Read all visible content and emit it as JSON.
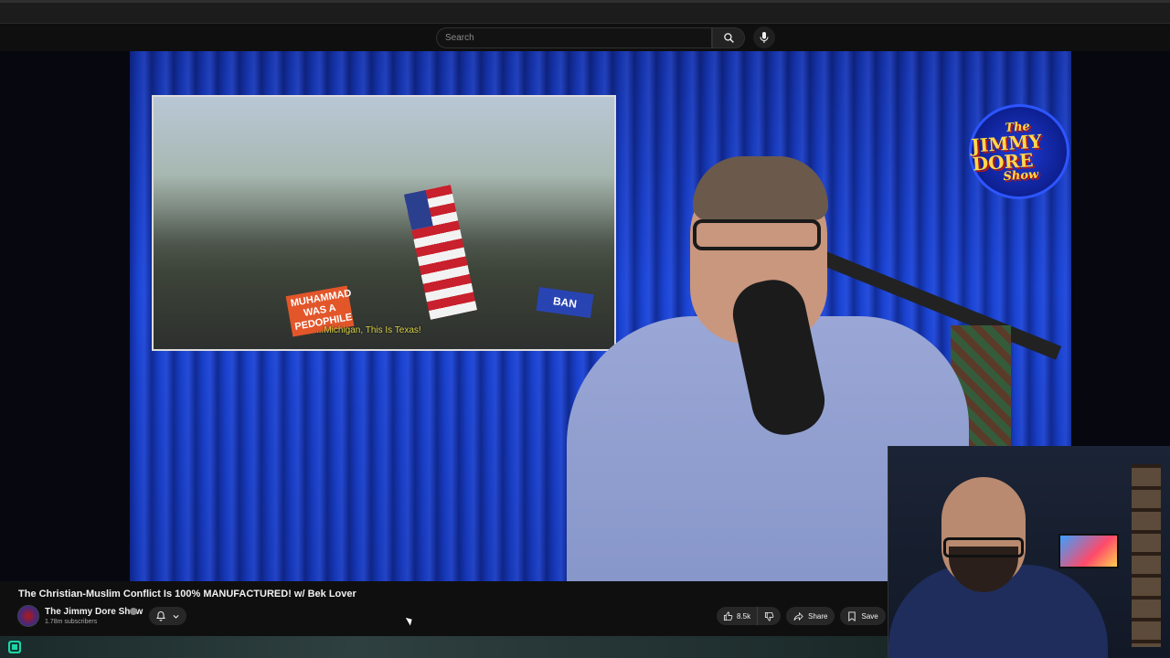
{
  "search": {
    "placeholder": "Search"
  },
  "video": {
    "inset_caption": "...Michigan, This Is Texas!",
    "sign_left": "MUHAMMAD WAS A PEDOPHILE",
    "sign_right": "BAN",
    "logo": {
      "line1": "The",
      "line2": "JIMMY DORE",
      "line3": "Show"
    }
  },
  "info": {
    "title": "The Christian-Muslim Conflict Is 100% MANUFACTURED! w/ Bek Lover",
    "channel_name": "The Jimmy Dore Show",
    "subscribers": "1.78m subscribers",
    "like_count": "8.5k",
    "share_label": "Share",
    "save_label": "Save"
  },
  "colors": {
    "accent_blue": "#1b45d6",
    "background": "#0f0f0f",
    "taskbar_icon": "#1fd3a8"
  },
  "icons": [
    "search-icon",
    "mic-icon",
    "bell-icon",
    "chevron-down-icon",
    "thumbs-up-icon",
    "thumbs-down-icon",
    "share-icon",
    "bookmark-icon",
    "verified-icon",
    "app-icon"
  ]
}
